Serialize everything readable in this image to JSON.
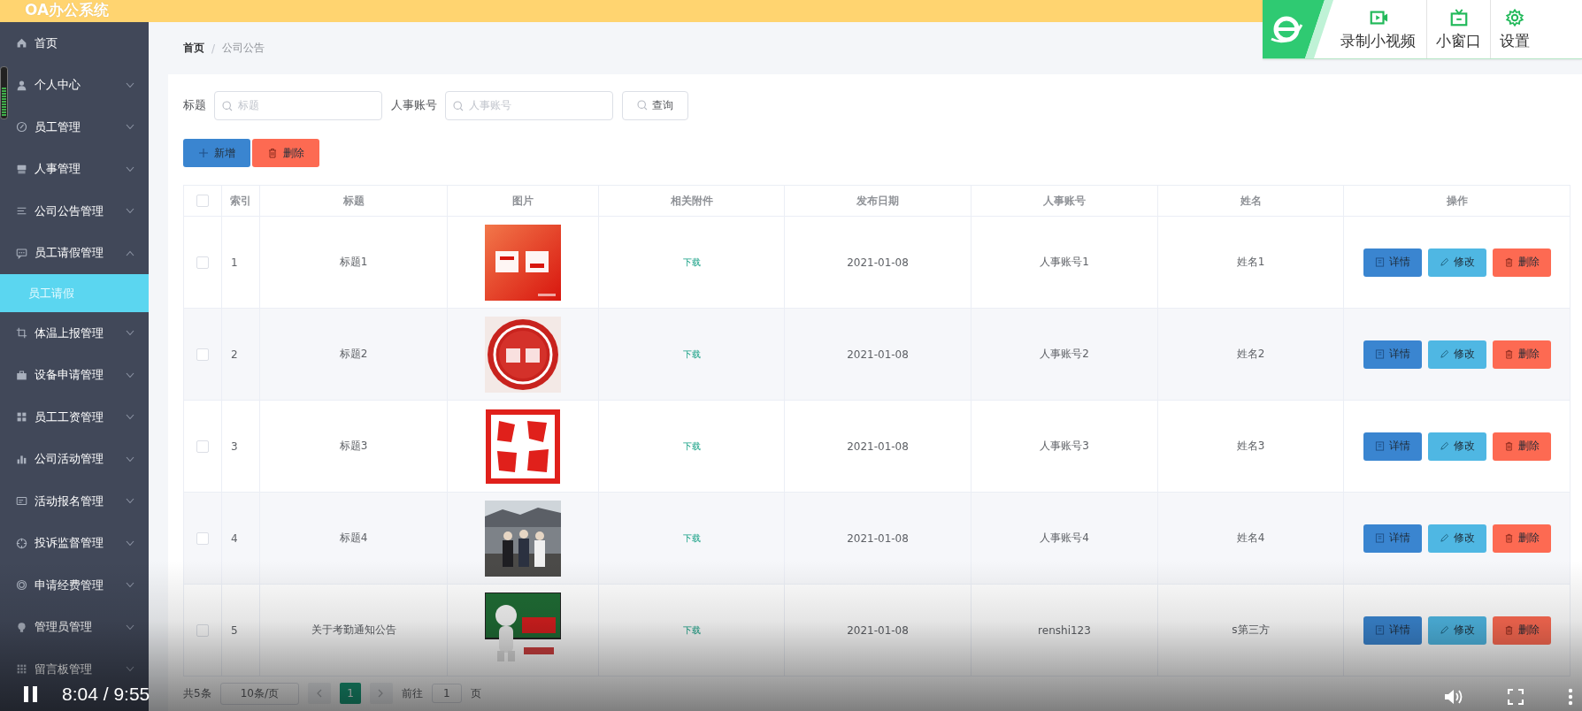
{
  "header": {
    "title": "OA办公系统"
  },
  "sidebar": {
    "items": [
      {
        "label": "首页",
        "kind": "link",
        "selected": false
      },
      {
        "label": "个人中心",
        "kind": "submenu",
        "expanded": false,
        "selected": false
      },
      {
        "label": "员工管理",
        "kind": "submenu",
        "expanded": false,
        "selected": false
      },
      {
        "label": "人事管理",
        "kind": "submenu",
        "expanded": false,
        "selected": false
      },
      {
        "label": "公司公告管理",
        "kind": "submenu",
        "expanded": false,
        "selected": false
      },
      {
        "label": "员工请假管理",
        "kind": "submenu",
        "expanded": true,
        "selected": false,
        "children": [
          {
            "label": "员工请假",
            "selected": true
          }
        ]
      },
      {
        "label": "体温上报管理",
        "kind": "submenu",
        "expanded": false,
        "selected": false
      },
      {
        "label": "设备申请管理",
        "kind": "submenu",
        "expanded": false,
        "selected": false
      },
      {
        "label": "员工工资管理",
        "kind": "submenu",
        "expanded": false,
        "selected": false
      },
      {
        "label": "公司活动管理",
        "kind": "submenu",
        "expanded": false,
        "selected": false
      },
      {
        "label": "活动报名管理",
        "kind": "submenu",
        "expanded": false,
        "selected": false
      },
      {
        "label": "投诉监督管理",
        "kind": "submenu",
        "expanded": false,
        "selected": false
      },
      {
        "label": "申请经费管理",
        "kind": "submenu",
        "expanded": false,
        "selected": false
      },
      {
        "label": "管理员管理",
        "kind": "submenu",
        "expanded": false,
        "selected": false
      },
      {
        "label": "留言板管理",
        "kind": "submenu",
        "expanded": false,
        "selected": false
      }
    ]
  },
  "breadcrumb": {
    "separator": "/",
    "items": [
      "首页",
      "公司公告"
    ]
  },
  "search": {
    "fields": [
      {
        "label": "标题",
        "placeholder": "标题"
      },
      {
        "label": "人事账号",
        "placeholder": "人事账号"
      }
    ],
    "button": "查询"
  },
  "actions": [
    {
      "label": "新增",
      "kind": "add"
    },
    {
      "label": "删除",
      "kind": "delete"
    }
  ],
  "table": {
    "all_checked": false,
    "columns": [
      "索引",
      "标题",
      "图片",
      "相关附件",
      "发布日期",
      "人事账号",
      "姓名",
      "操作"
    ],
    "rows": [
      {
        "checked": false,
        "index": "1",
        "title": "标题1",
        "attachment": "下载",
        "date": "2021-01-08",
        "account": "人事账号1",
        "name": "姓名1",
        "actions": [
          {
            "label": "详情",
            "kind": "detail"
          },
          {
            "label": "修改",
            "kind": "edit"
          },
          {
            "label": "删除",
            "kind": "delete"
          }
        ]
      },
      {
        "checked": false,
        "index": "2",
        "title": "标题2",
        "attachment": "下载",
        "date": "2021-01-08",
        "account": "人事账号2",
        "name": "姓名2",
        "actions": [
          {
            "label": "详情",
            "kind": "detail"
          },
          {
            "label": "修改",
            "kind": "edit"
          },
          {
            "label": "删除",
            "kind": "delete"
          }
        ]
      },
      {
        "checked": false,
        "index": "3",
        "title": "标题3",
        "attachment": "下载",
        "date": "2021-01-08",
        "account": "人事账号3",
        "name": "姓名3",
        "actions": [
          {
            "label": "详情",
            "kind": "detail"
          },
          {
            "label": "修改",
            "kind": "edit"
          },
          {
            "label": "删除",
            "kind": "delete"
          }
        ]
      },
      {
        "checked": false,
        "index": "4",
        "title": "标题4",
        "attachment": "下载",
        "date": "2021-01-08",
        "account": "人事账号4",
        "name": "姓名4",
        "actions": [
          {
            "label": "详情",
            "kind": "detail"
          },
          {
            "label": "修改",
            "kind": "edit"
          },
          {
            "label": "删除",
            "kind": "delete"
          }
        ]
      },
      {
        "checked": false,
        "index": "5",
        "title": "关于考勤通知公告",
        "attachment": "下载",
        "date": "2021-01-08",
        "account": "renshi123",
        "name": "s第三方",
        "actions": [
          {
            "label": "详情",
            "kind": "detail"
          },
          {
            "label": "修改",
            "kind": "edit"
          },
          {
            "label": "删除",
            "kind": "delete"
          }
        ]
      }
    ]
  },
  "pagination": {
    "total": "共5条",
    "page_size": "10条/页",
    "pages": [
      {
        "label": "1",
        "selected": true
      }
    ],
    "goto_label": "前往",
    "goto_value": "1",
    "page_unit": "页"
  },
  "player": {
    "playing": true,
    "time": "8:04 / 9:55"
  },
  "browser_toolbar": {
    "buttons": [
      {
        "label": "录制小视频",
        "kind": "record"
      },
      {
        "label": "小窗口",
        "kind": "mini"
      },
      {
        "label": "设置",
        "kind": "settings"
      }
    ]
  }
}
